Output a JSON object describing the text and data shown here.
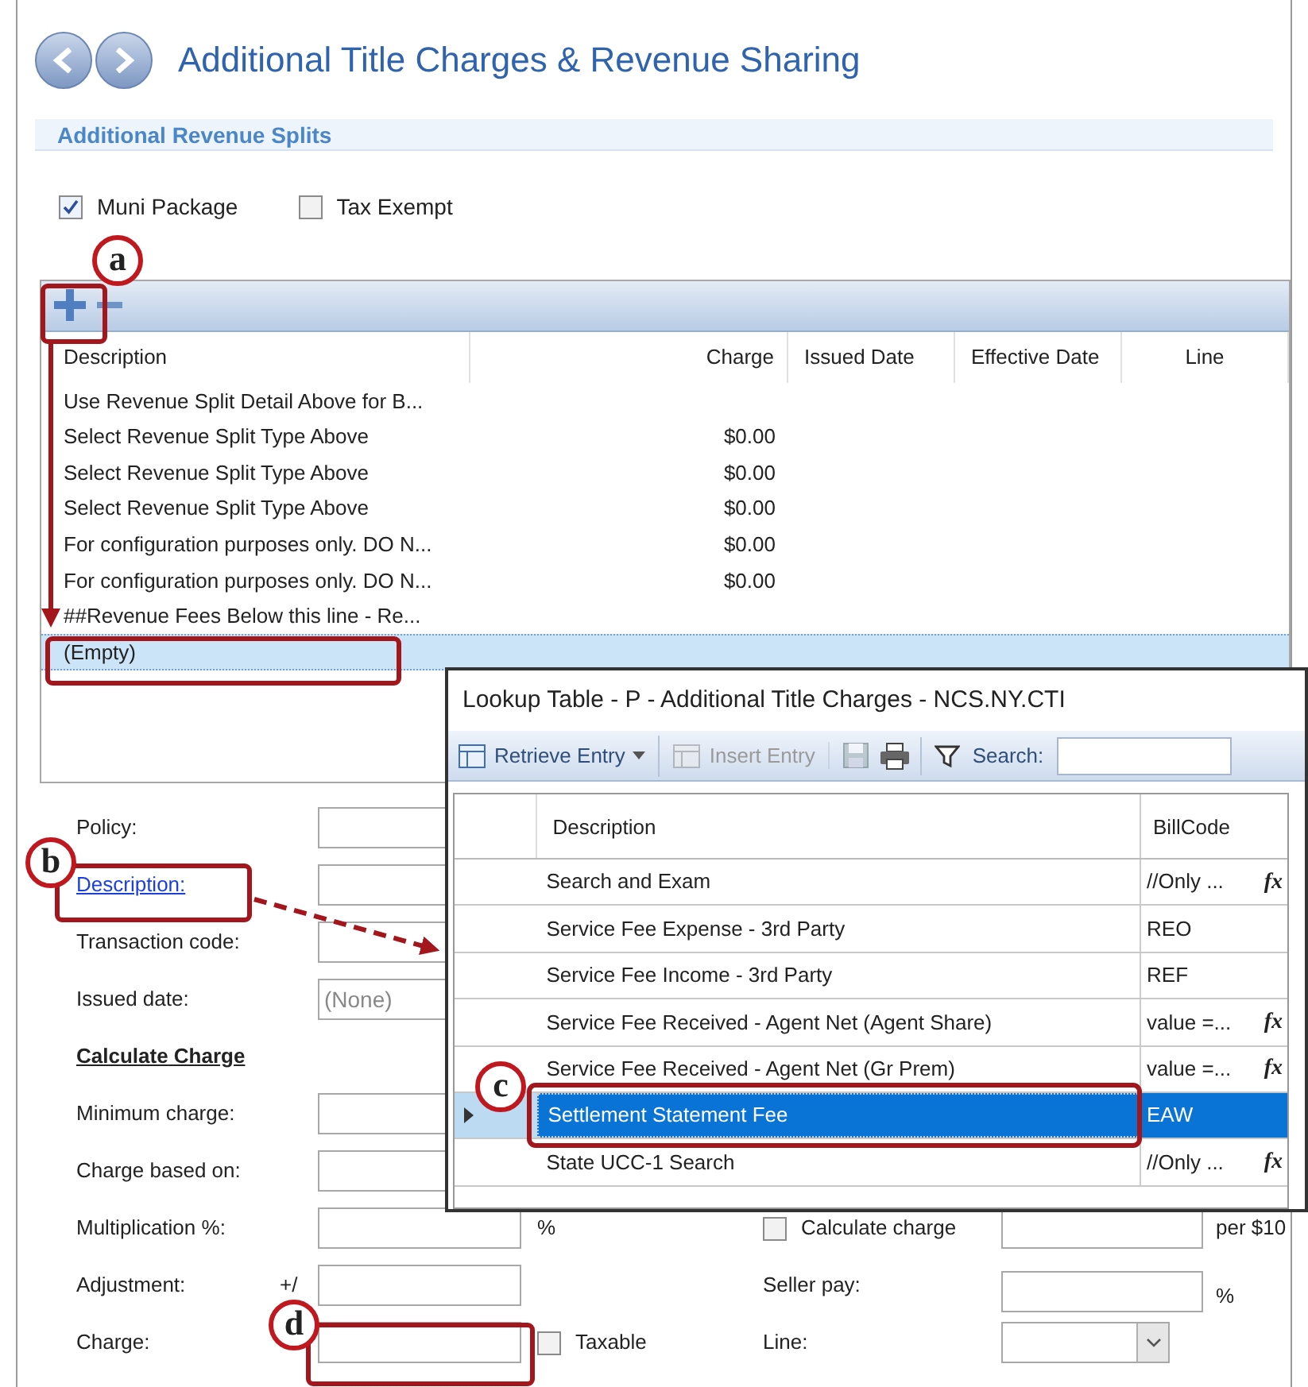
{
  "window": {
    "title": "Additional Title Charges & Revenue Sharing"
  },
  "section": {
    "title": "Additional Revenue Splits"
  },
  "options": [
    {
      "label": "Muni Package",
      "checked": true
    },
    {
      "label": "Tax Exempt",
      "checked": false
    }
  ],
  "grid": {
    "columns": [
      "Description",
      "Charge",
      "Issued Date",
      "Effective Date",
      "Line"
    ],
    "rows": [
      {
        "description": "Use Revenue Split Detail Above for B...",
        "selected": false
      },
      {
        "description": "Select Revenue Split Type Above",
        "charge": "$0.00",
        "selected": false
      },
      {
        "description": "Select Revenue Split Type Above",
        "charge": "$0.00",
        "selected": false
      },
      {
        "description": "Select Revenue Split Type Above",
        "charge": "$0.00",
        "selected": false
      },
      {
        "description": "For configuration purposes only. DO N...",
        "charge": "$0.00",
        "selected": false
      },
      {
        "description": "For configuration purposes only. DO N...",
        "charge": "$0.00",
        "selected": false
      },
      {
        "description": "##Revenue Fees Below this line - Re...",
        "selected": false
      },
      {
        "description": "(Empty)",
        "selected": true
      }
    ]
  },
  "form": {
    "rows": [
      {
        "kind": "input",
        "label": "Policy:"
      },
      {
        "kind": "link",
        "label": "Description:"
      },
      {
        "kind": "input",
        "label": "Transaction code:"
      },
      {
        "kind": "input",
        "label": "Issued date:",
        "placeholder": "(None)"
      },
      {
        "kind": "heading",
        "label": "Calculate Charge"
      },
      {
        "kind": "input",
        "label": "Minimum charge:"
      },
      {
        "kind": "input",
        "label": "Charge based on:"
      },
      {
        "kind": "input",
        "label": "Multiplication %:",
        "suffix": "%",
        "right": {
          "kind": "checkbox-input",
          "label": "Calculate charge",
          "checked": false,
          "after": "per $10"
        }
      },
      {
        "kind": "input",
        "label": "Adjustment:",
        "prefix": "+/",
        "right": {
          "kind": "input",
          "label": "Seller pay:",
          "suffix": "%"
        }
      },
      {
        "kind": "input",
        "label": "Charge:",
        "checkbox": {
          "label": "Taxable",
          "checked": false
        },
        "right": {
          "kind": "select",
          "label": "Line:"
        }
      }
    ]
  },
  "lookup": {
    "title": "Lookup Table - P - Additional Title Charges - NCS.NY.CTI",
    "toolbar": [
      {
        "kind": "menu",
        "label": "Retrieve Entry",
        "disabled": false
      },
      {
        "kind": "insert",
        "label": "Insert Entry",
        "disabled": true
      },
      {
        "kind": "save",
        "disabled": true
      },
      {
        "kind": "print",
        "disabled": false
      },
      {
        "kind": "filter",
        "label": "Search:",
        "disabled": false
      }
    ],
    "columns": [
      "Description",
      "BillCode"
    ],
    "rows": [
      {
        "description": "Search and Exam",
        "billcode": "//Only ...",
        "formula": "fx",
        "selected": false
      },
      {
        "description": "Service Fee Expense - 3rd Party",
        "billcode": "REO",
        "selected": false
      },
      {
        "description": "Service Fee Income - 3rd Party",
        "billcode": "REF",
        "selected": false
      },
      {
        "description": "Service Fee Received - Agent Net (Agent Share)",
        "billcode": "value =...",
        "formula": "fx",
        "selected": false
      },
      {
        "description": "Service Fee Received - Agent Net (Gr Prem)",
        "billcode": "value =...",
        "formula": "fx",
        "selected": false
      },
      {
        "description": "Settlement Statement Fee",
        "billcode": "EAW",
        "selected": true
      },
      {
        "description": "State UCC-1 Search",
        "billcode": "//Only ...",
        "formula": "fx",
        "selected": false
      }
    ]
  },
  "callouts": [
    {
      "label": "a"
    },
    {
      "label": "b"
    },
    {
      "label": "c"
    },
    {
      "label": "d"
    }
  ]
}
